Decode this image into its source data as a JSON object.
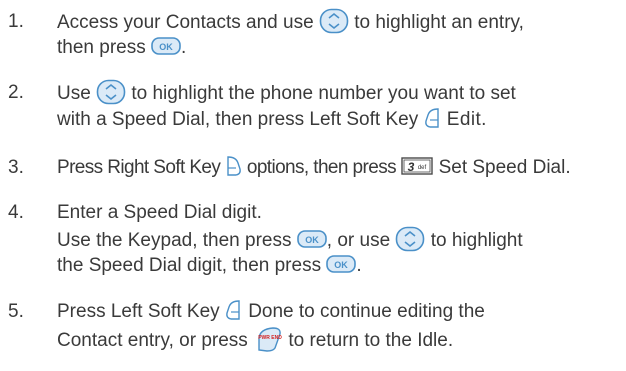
{
  "steps": [
    {
      "number": "1.",
      "line1": {
        "a": "Access your Contacts and use",
        "b": "to highlight an entry,"
      },
      "line2": {
        "a": "then press",
        "b": "."
      }
    },
    {
      "number": "2.",
      "line1": {
        "a": "Use",
        "b": "to highlight the phone number you want to set"
      },
      "line2": {
        "a": "with a Speed Dial, then press  Left Soft Key",
        "b": "Edit",
        "c": "."
      }
    },
    {
      "number": "3.",
      "line1": {
        "a": "Press Right Soft Key",
        "b": "options, then press",
        "c": "Set Speed Dial."
      }
    },
    {
      "number": "4.",
      "line1": {
        "a": "Enter a Speed Dial digit."
      },
      "line2": {
        "a": "Use the Keypad,",
        "b": "then press",
        "c": ", or use",
        "d": "to highlight"
      },
      "line3": {
        "a": "the Speed Dial digit,",
        "b": "then press",
        "c": "."
      }
    },
    {
      "number": "5.",
      "line1": {
        "a": "Press Left Soft Key",
        "b": "Done to continue editing the"
      },
      "line2": {
        "a": "Contact entry, or press",
        "b": "to return to the Idle."
      }
    }
  ],
  "icons": {
    "ok_label": "OK",
    "key3_digit": "3",
    "key3_letters": "def",
    "end_label": "PWR END"
  },
  "colors": {
    "text": "#3a3a3a",
    "icon_stroke": "#4a90c8",
    "icon_fill": "#dbeaf7"
  }
}
